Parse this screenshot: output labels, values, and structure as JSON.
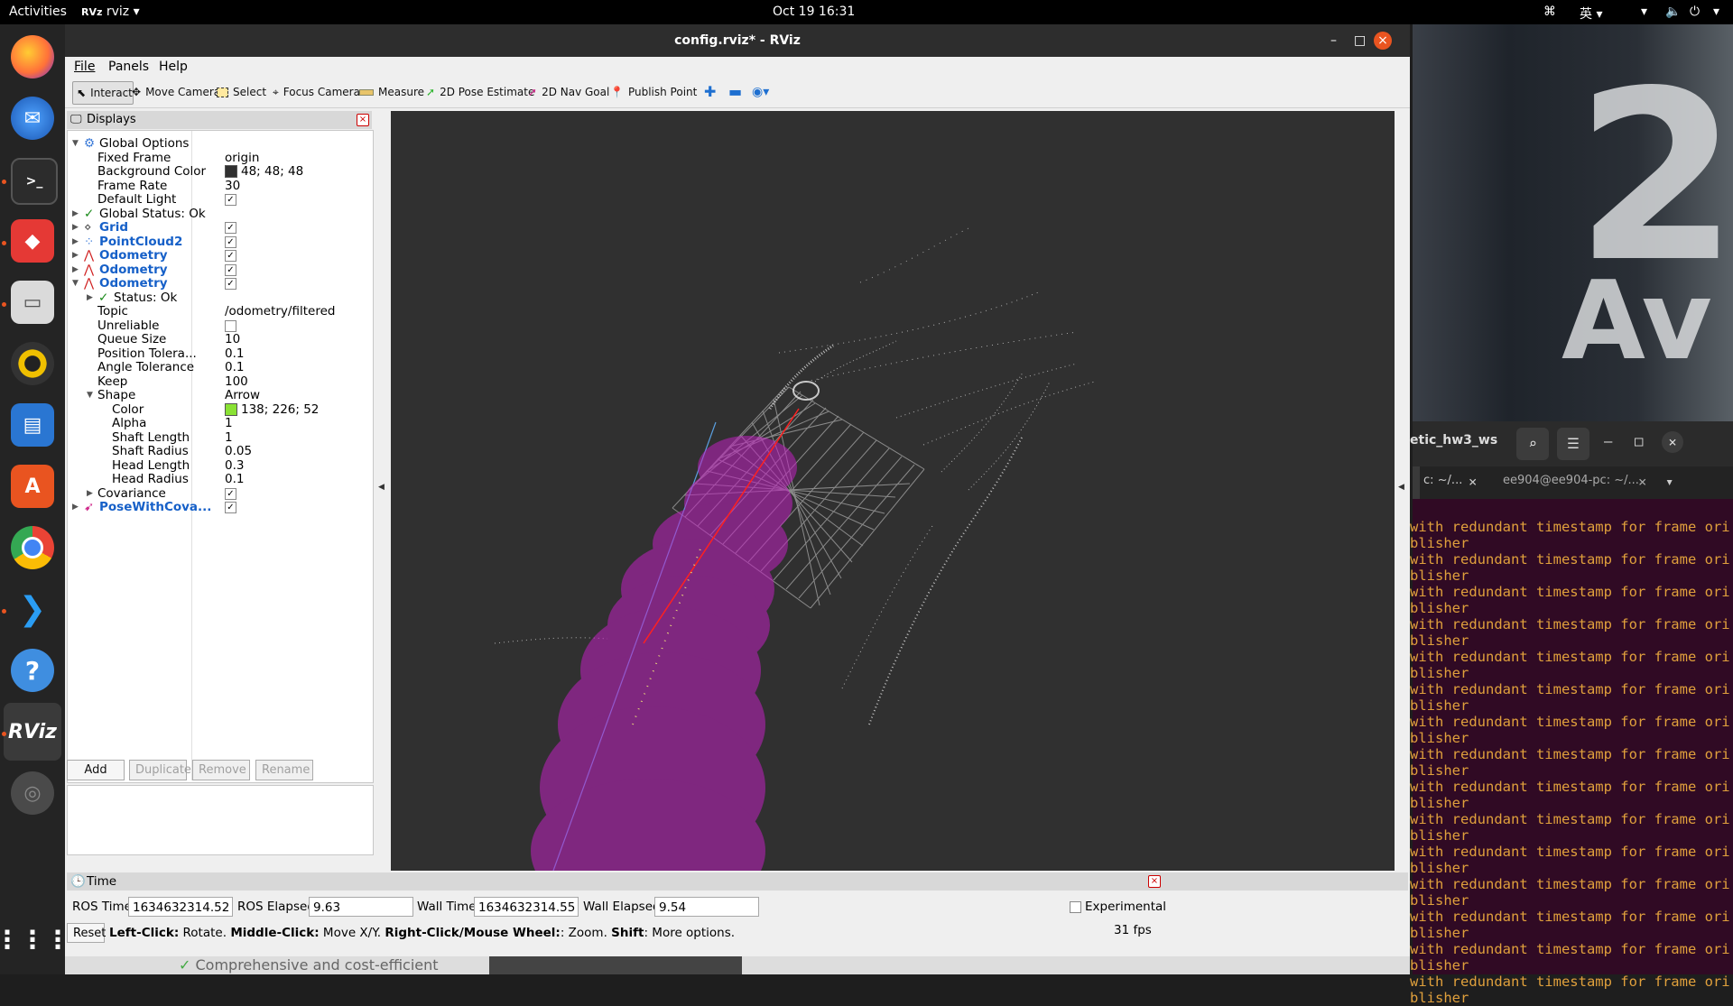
{
  "topbar": {
    "activities": "Activities",
    "app": "rviz",
    "clock": "Oct 19  16:31",
    "ime": "英"
  },
  "window": {
    "title": "config.rviz* - RViz"
  },
  "menu": {
    "file": "File",
    "panels": "Panels",
    "help": "Help"
  },
  "toolbar": {
    "interact": "Interact",
    "move_camera": "Move Camera",
    "select": "Select",
    "focus_camera": "Focus Camera",
    "measure": "Measure",
    "pose_estimate": "2D Pose Estimate",
    "nav_goal": "2D Nav Goal",
    "publish_point": "Publish Point"
  },
  "displays": {
    "title": "Displays",
    "rows": [
      {
        "label": "Global Options",
        "value": ""
      },
      {
        "label": "Fixed Frame",
        "value": "origin"
      },
      {
        "label": "Background Color",
        "value": "48; 48; 48"
      },
      {
        "label": "Frame Rate",
        "value": "30"
      },
      {
        "label": "Default Light",
        "value": ""
      },
      {
        "label": "Global Status: Ok",
        "value": ""
      },
      {
        "label": "Grid",
        "value": ""
      },
      {
        "label": "PointCloud2",
        "value": ""
      },
      {
        "label": "Odometry",
        "value": ""
      },
      {
        "label": "Odometry",
        "value": ""
      },
      {
        "label": "Odometry",
        "value": ""
      },
      {
        "label": "Status: Ok",
        "value": ""
      },
      {
        "label": "Topic",
        "value": "/odometry/filtered"
      },
      {
        "label": "Unreliable",
        "value": ""
      },
      {
        "label": "Queue Size",
        "value": "10"
      },
      {
        "label": "Position Tolera...",
        "value": "0.1"
      },
      {
        "label": "Angle Tolerance",
        "value": "0.1"
      },
      {
        "label": "Keep",
        "value": "100"
      },
      {
        "label": "Shape",
        "value": "Arrow"
      },
      {
        "label": "Color",
        "value": "138; 226; 52"
      },
      {
        "label": "Alpha",
        "value": "1"
      },
      {
        "label": "Shaft Length",
        "value": "1"
      },
      {
        "label": "Shaft Radius",
        "value": "0.05"
      },
      {
        "label": "Head Length",
        "value": "0.3"
      },
      {
        "label": "Head Radius",
        "value": "0.1"
      },
      {
        "label": "Covariance",
        "value": ""
      },
      {
        "label": "PoseWithCova...",
        "value": ""
      }
    ],
    "colors": {
      "background": "#303030",
      "odometry": "#8ae234"
    },
    "buttons": {
      "add": "Add",
      "duplicate": "Duplicate",
      "remove": "Remove",
      "rename": "Rename"
    }
  },
  "time": {
    "title": "Time",
    "ros_time_label": "ROS Time:",
    "ros_time": "1634632314.52",
    "ros_elapsed_label": "ROS Elapsed:",
    "ros_elapsed": "9.63",
    "wall_time_label": "Wall Time:",
    "wall_time": "1634632314.55",
    "wall_elapsed_label": "Wall Elapsed:",
    "wall_elapsed": "9.54",
    "experimental": "Experimental",
    "reset": "Reset",
    "hint_b1": "Left-Click:",
    "hint_t1": " Rotate. ",
    "hint_b2": "Middle-Click:",
    "hint_t2": " Move X/Y. ",
    "hint_b3": "Right-Click/Mouse Wheel:",
    "hint_t3": ": Zoom. ",
    "hint_b4": "Shift",
    "hint_t4": ": More options.",
    "fps": "31 fps"
  },
  "terminal": {
    "title": "etic_hw3_ws",
    "tab1": "c: ~/...",
    "tab2": "ee904@ee904-pc: ~/...",
    "line_a": "with redundant timestamp for frame ori",
    "line_b": "blisher"
  },
  "wallpaper": {
    "text_big": "2",
    "text_small": "Av"
  },
  "behind": {
    "text": "Comprehensive and cost-efficient"
  }
}
